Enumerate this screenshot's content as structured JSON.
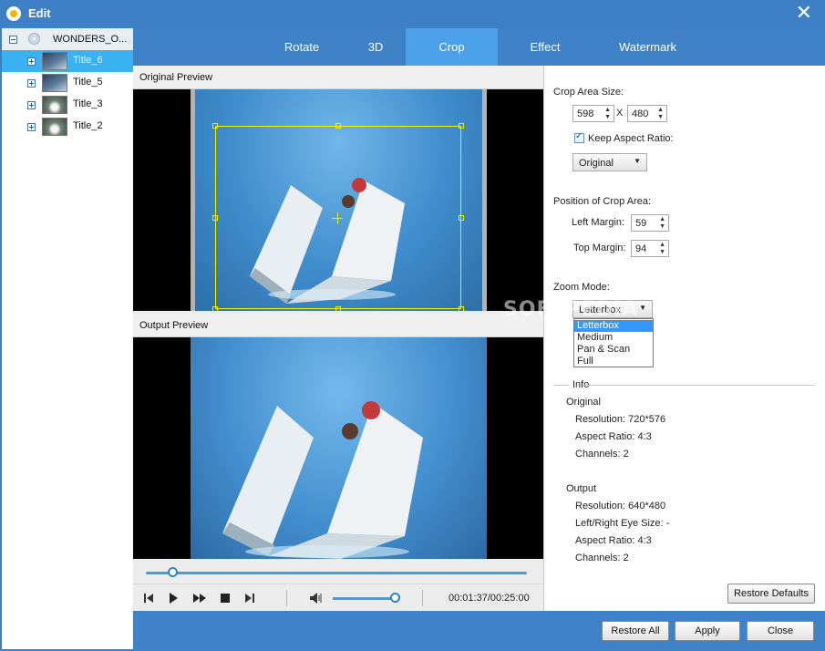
{
  "window": {
    "title": "Edit",
    "close_symbol": "✕"
  },
  "tree": {
    "root": {
      "label": "WONDERS_O...",
      "expander": "minus"
    },
    "items": [
      {
        "label": "Title_6",
        "selected": true
      },
      {
        "label": "Title_5",
        "selected": false
      },
      {
        "label": "Title_3",
        "selected": false
      },
      {
        "label": "Title_2",
        "selected": false
      }
    ]
  },
  "tabs": [
    "Rotate",
    "3D",
    "Crop",
    "Effect",
    "Watermark"
  ],
  "active_tab": "Crop",
  "preview": {
    "original_label": "Original Preview",
    "output_label": "Output Preview",
    "seek_progress": 0.07,
    "volume_level": 0.95,
    "time": "00:01:37/00:25:00"
  },
  "crop": {
    "area_size_label": "Crop Area Size:",
    "width": "598",
    "x_sep": "X",
    "height": "480",
    "keep_aspect_label": "Keep Aspect Ratio:",
    "keep_aspect_checked": true,
    "aspect_value": "Original",
    "position_label": "Position of Crop Area:",
    "left_margin_label": "Left Margin:",
    "left_margin": "59",
    "top_margin_label": "Top Margin:",
    "top_margin": "94",
    "zoom_label": "Zoom Mode:",
    "zoom_value": "Letterbox",
    "zoom_options": [
      "Letterbox",
      "Medium",
      "Pan & Scan",
      "Full"
    ]
  },
  "info": {
    "header": "Info",
    "original": {
      "label": "Original",
      "resolution": "Resolution: 720*576",
      "aspect": "Aspect Ratio: 4:3",
      "channels": "Channels: 2"
    },
    "output": {
      "label": "Output",
      "resolution": "Resolution: 640*480",
      "eye_size": "Left/Right Eye Size: -",
      "aspect": "Aspect Ratio: 4:3",
      "channels": "Channels: 2"
    }
  },
  "buttons": {
    "restore_defaults": "Restore Defaults",
    "restore_all": "Restore All",
    "apply": "Apply",
    "close": "Close"
  },
  "watermark_text": "SOFTPEDIA",
  "colors": {
    "accent": "#3f82c8",
    "tab_active": "#4ba0e8",
    "selected_row": "#3ab1f0",
    "crop_frame": "#f2f200"
  }
}
